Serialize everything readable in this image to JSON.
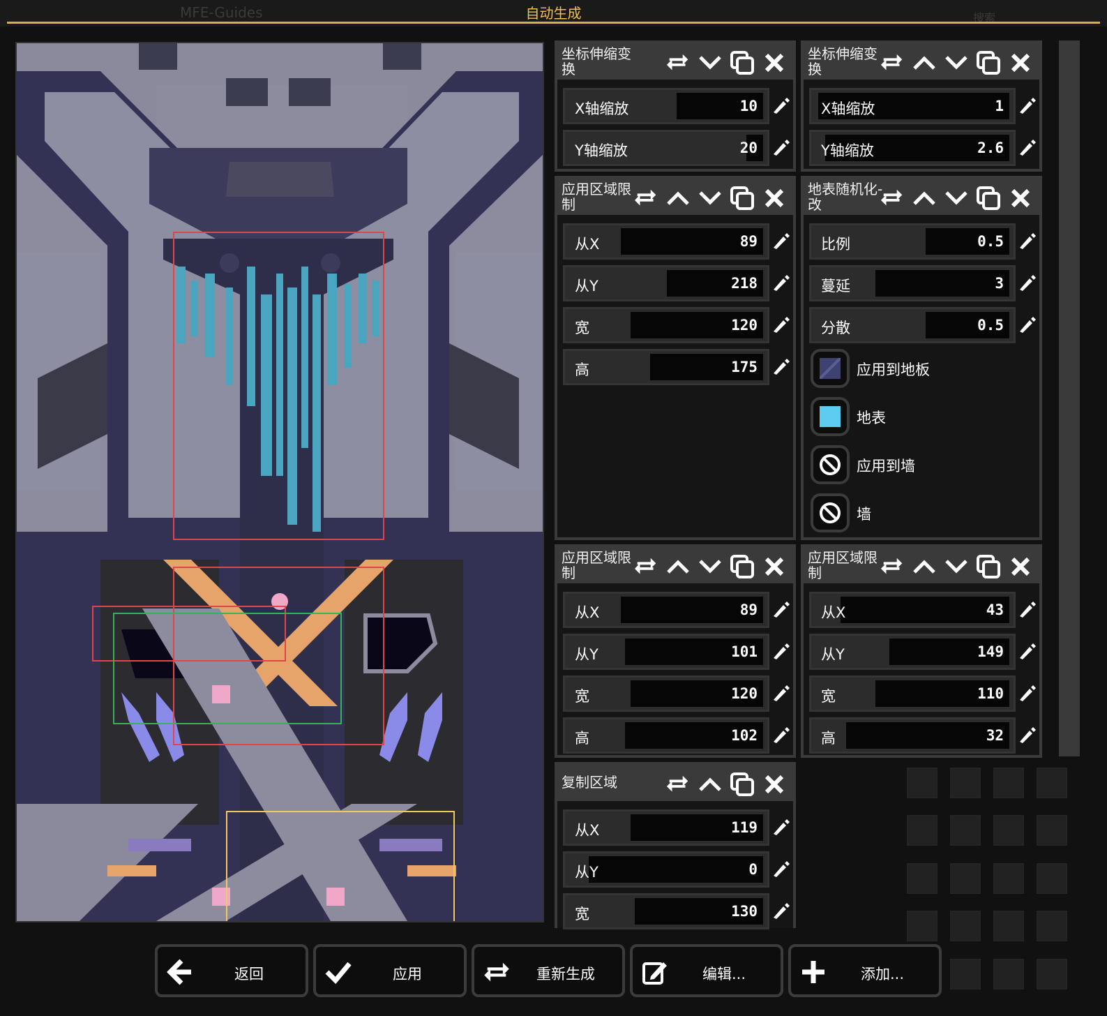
{
  "background": {
    "tab_label": "MFE-Guides",
    "search_placeholder": "搜索"
  },
  "header": {
    "title": "自动生成"
  },
  "panels": [
    {
      "title": "坐标伸缩变换",
      "fields": [
        {
          "label": "X轴缩放",
          "value": "10"
        },
        {
          "label": "Y轴缩放",
          "value": "20"
        }
      ]
    },
    {
      "title": "坐标伸缩变换",
      "fields": [
        {
          "label": "X轴缩放",
          "value": "1"
        },
        {
          "label": "Y轴缩放",
          "value": "2.6"
        }
      ]
    },
    {
      "title": "应用区域限制",
      "fields": [
        {
          "label": "从X",
          "value": "89"
        },
        {
          "label": "从Y",
          "value": "218"
        },
        {
          "label": "宽",
          "value": "120"
        },
        {
          "label": "高",
          "value": "175"
        }
      ]
    },
    {
      "title": "地表随机化-改",
      "fields": [
        {
          "label": "比例",
          "value": "0.5"
        },
        {
          "label": "蔓延",
          "value": "3"
        },
        {
          "label": "分散",
          "value": "0.5"
        }
      ],
      "toggles": [
        {
          "label": "应用到地板",
          "icon": "floor-tile-icon"
        },
        {
          "label": "地表",
          "icon": "surface-tile-icon"
        },
        {
          "label": "应用到墙",
          "icon": "blocked-icon"
        },
        {
          "label": "墙",
          "icon": "blocked-icon"
        }
      ]
    },
    {
      "title": "应用区域限制",
      "fields": [
        {
          "label": "从X",
          "value": "89"
        },
        {
          "label": "从Y",
          "value": "101"
        },
        {
          "label": "宽",
          "value": "120"
        },
        {
          "label": "高",
          "value": "102"
        }
      ]
    },
    {
      "title": "应用区域限制",
      "fields": [
        {
          "label": "从X",
          "value": "43"
        },
        {
          "label": "从Y",
          "value": "149"
        },
        {
          "label": "宽",
          "value": "110"
        },
        {
          "label": "高",
          "value": "32"
        }
      ]
    },
    {
      "title": "复制区域",
      "fields": [
        {
          "label": "从X",
          "value": "119"
        },
        {
          "label": "从Y",
          "value": "0"
        },
        {
          "label": "宽",
          "value": "130"
        }
      ]
    }
  ],
  "buttons": {
    "back": "返回",
    "apply": "应用",
    "regenerate": "重新生成",
    "edit": "编辑...",
    "add": "添加..."
  },
  "colors": {
    "accent": "#f2c14e",
    "surface_tile": "#5ccdf0",
    "floor_tile": "#3f4270",
    "region_red": "#e0454a",
    "region_green": "#35b356",
    "region_yellow": "#f0c860"
  }
}
